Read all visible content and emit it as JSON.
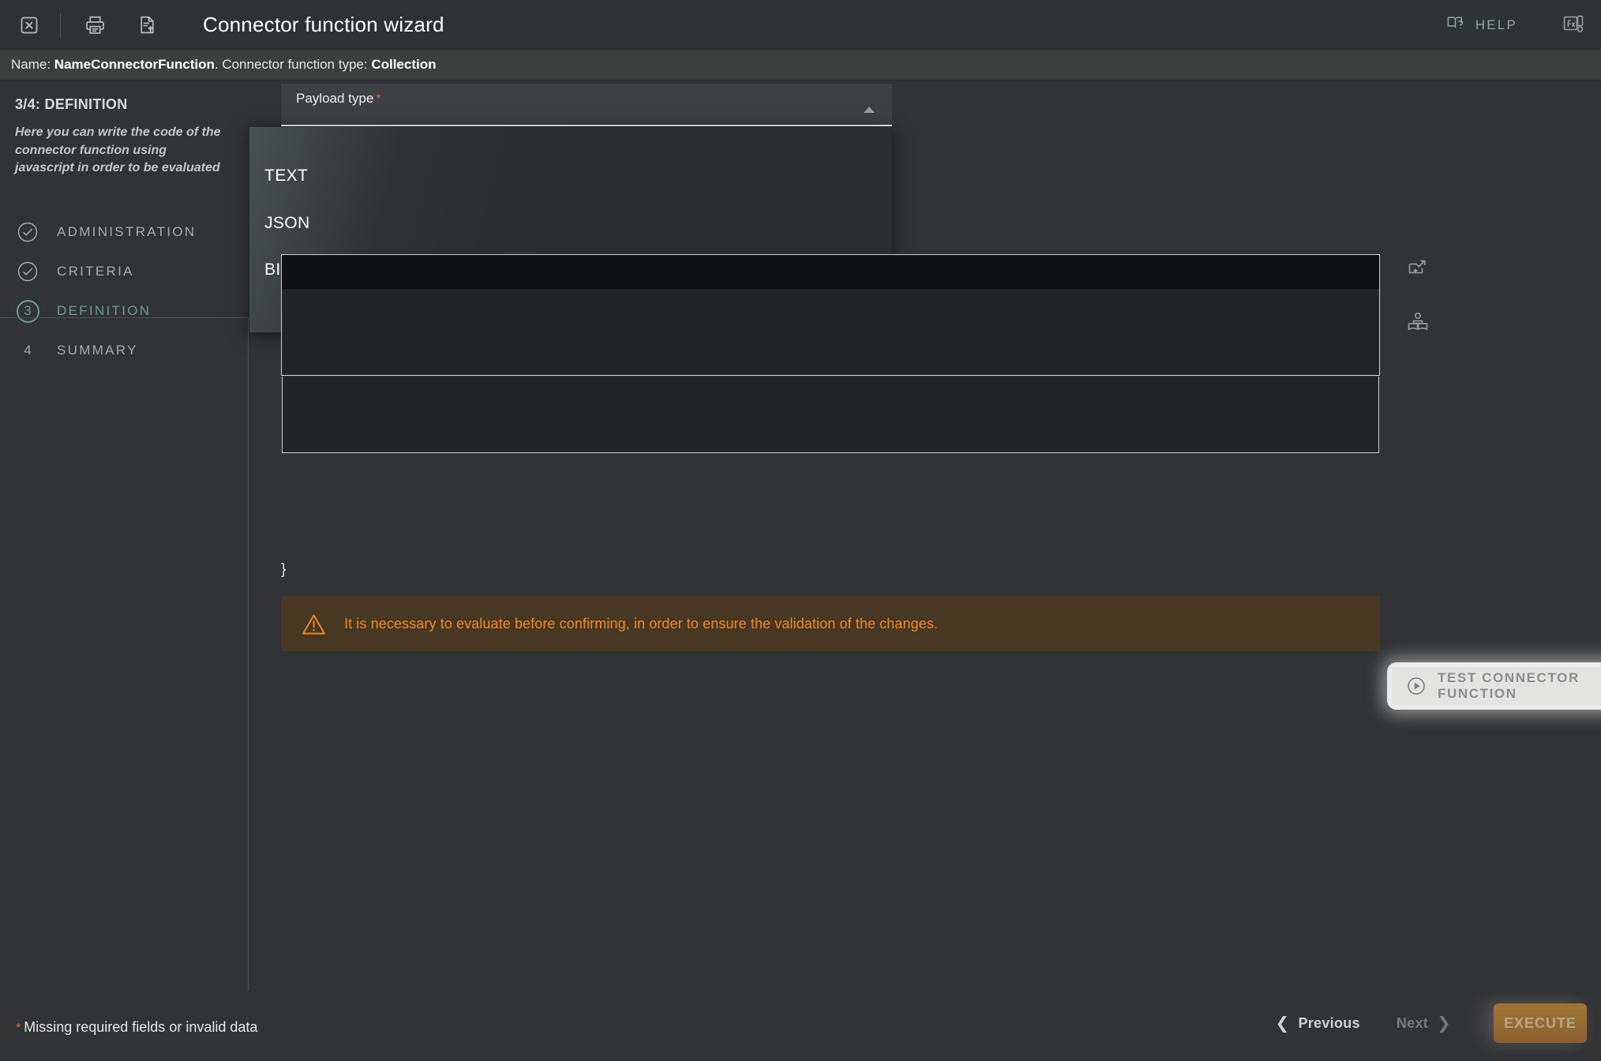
{
  "window": {
    "title": "Connector function wizard",
    "toolbar": {
      "close_label": "close-window",
      "print_label": "print",
      "export_label": "export-document"
    },
    "help_label": "HELP",
    "fx_label": "fx"
  },
  "namebar": {
    "name_prefix": "Name: ",
    "name_value": "NameConnectorFunction",
    "type_prefix": ". Connector function type: ",
    "type_value": "Collection"
  },
  "sidebar": {
    "step_header": "3/4: DEFINITION",
    "description": "Here you can write the code of the connector function using javascript in order to be evaluated",
    "items": [
      {
        "label": "ADMINISTRATION",
        "marker": "check",
        "state": "done"
      },
      {
        "label": "CRITERIA",
        "marker": "check",
        "state": "done"
      },
      {
        "label": "DEFINITION",
        "marker": "3",
        "state": "active"
      },
      {
        "label": "SUMMARY",
        "marker": "4",
        "state": "pending"
      }
    ]
  },
  "main": {
    "payload_field": {
      "label": "Payload type",
      "required_marker": "*",
      "value": "",
      "caret": "chevron-up-icon",
      "options": [
        "TEXT",
        "JSON",
        "BINARY"
      ]
    },
    "code_closing_brace": "}",
    "side_icons": [
      {
        "name": "open-in-new-window-add-icon"
      },
      {
        "name": "documentation-reader-icon"
      }
    ],
    "warning": {
      "icon": "warning-triangle-icon",
      "text": "It is necessary to evaluate before confirming, in order to ensure the validation of the changes."
    },
    "test_button": {
      "label": "TEST CONNECTOR FUNCTION",
      "icon": "play-circle-icon"
    }
  },
  "footer": {
    "required_marker": "*",
    "missing_text": "Missing required fields or invalid data",
    "previous_label": "Previous",
    "next_label": "Next",
    "execute_label": "EXECUTE"
  },
  "colors": {
    "background": "#313335",
    "topbar": "#2f3234",
    "namebar": "#3b403f",
    "accent_teal": "#6d9a96",
    "required_red": "#e05a3a",
    "warning_orange": "#f08a22",
    "warning_bg": "#473723",
    "execute_amber": "#a07434"
  }
}
